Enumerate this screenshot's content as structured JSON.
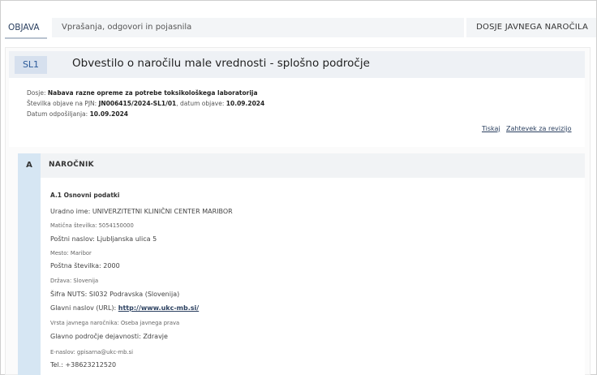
{
  "tabs": {
    "objava": "OBJAVA",
    "vprasanja": "Vprašanja, odgovori in pojasnila",
    "dosje": "DOSJE JAVNEGA NAROČILA"
  },
  "notice": {
    "badge": "SL1",
    "title": "Obvestilo o naročilu male vrednosti - splošno področje",
    "dosje_label": "Dosje: ",
    "dosje_value": "Nabava razne opreme za potrebe toksikološkega laboratorija",
    "stevilka_label": "Številka objave na PJN: ",
    "stevilka_value": "JN006415/2024-SL1/01",
    "datum_objave_label": ", datum objave: ",
    "datum_objave_value": "10.09.2024",
    "datum_odposiljanja_label": "Datum odpošiljanja: ",
    "datum_odposiljanja_value": "10.09.2024",
    "tiskaj": "Tiskaj",
    "zahtevek": "Zahtevek za revizijo"
  },
  "section_a": {
    "letter": "A",
    "title": "NAROČNIK",
    "subhead": "A.1 Osnovni podatki",
    "rows": [
      {
        "label": "Uradno ime: ",
        "value": "UNIVERZITETNI KLINIČNI CENTER MARIBOR"
      },
      {
        "label": "Matična številka: ",
        "value": "5054150000"
      },
      {
        "label": "Poštni naslov: ",
        "value": "Ljubljanska ulica 5"
      },
      {
        "label": "Mesto: ",
        "value": "Maribor"
      },
      {
        "label": "Poštna številka: ",
        "value": "2000"
      },
      {
        "label": "Država: ",
        "value": "Slovenija"
      },
      {
        "label": "Šifra NUTS: ",
        "value": "SI032 Podravska (Slovenija)"
      },
      {
        "label": "Glavni naslov (URL): ",
        "value": "http://www.ukc-mb.si/"
      },
      {
        "label": "Vrsta javnega naročnika: ",
        "value": "Oseba javnega prava"
      },
      {
        "label": "Glavno področje dejavnosti: ",
        "value": "Zdravje"
      },
      {
        "label": "E-naslov: ",
        "value": "gpisarna@ukc-mb.si"
      },
      {
        "label": "Tel.: ",
        "value": "+38623212520"
      }
    ]
  }
}
